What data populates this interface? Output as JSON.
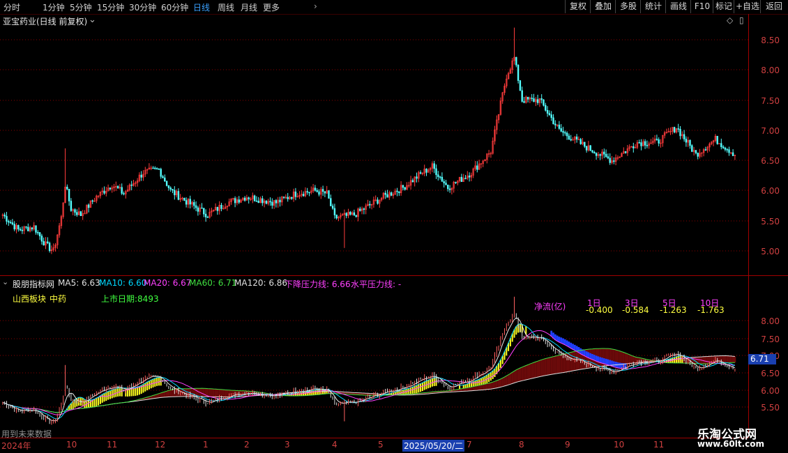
{
  "toolbar": {
    "timeframes": [
      "分时",
      "1分钟",
      "5分钟",
      "15分钟",
      "30分钟",
      "60分钟",
      "日线",
      "周线",
      "月线",
      "更多"
    ],
    "active_timeframe": "日线",
    "buttons": [
      "复权",
      "叠加",
      "多股",
      "统计",
      "画线",
      "F10",
      "标记",
      "+自选",
      "返回"
    ]
  },
  "main_panel": {
    "title": "亚宝药业(日线 前复权)",
    "y_ticks": [
      "8.50",
      "8.00",
      "7.50",
      "7.00",
      "6.50",
      "6.00",
      "5.50",
      "5.00"
    ]
  },
  "indicator_panel": {
    "name": "股朋指标网",
    "ma_items": [
      {
        "label": "MA5: 6.63",
        "color": "#e0e0e0"
      },
      {
        "label": "MA10: 6.60",
        "color": "#00d8ff"
      },
      {
        "label": "MA20: 6.67",
        "color": "#ff40ff"
      },
      {
        "label": "MA60: 6.71",
        "color": "#40e040"
      },
      {
        "label": "MA120: 6.86",
        "color": "#e0e0e0"
      },
      {
        "label": "下降压力线: 6.66",
        "color": "#ff40ff"
      },
      {
        "label": "水平压力线: -",
        "color": "#ff40ff"
      }
    ],
    "sector": "山西板块",
    "industry": "中药",
    "listing": "上市日期:8493",
    "netflow": {
      "label": "净流(亿)",
      "periods": [
        "1日",
        "3日",
        "5日",
        "10日"
      ],
      "values": [
        "-0.400",
        "-0.584",
        "-1.263",
        "-1.763"
      ]
    },
    "y_ticks": [
      "8.00",
      "7.50",
      "7.00",
      "6.50",
      "6.00",
      "5.50"
    ],
    "current_value": "6.71",
    "future_data_note": "用到未来数据"
  },
  "x_axis": {
    "labels": [
      "2024年",
      "10",
      "11",
      "12",
      "1",
      "2",
      "3",
      "4",
      "5",
      "2025/05/20/二",
      "7",
      "8",
      "9",
      "10",
      "11"
    ]
  },
  "watermark": {
    "title": "乐淘公式网",
    "url": "www.60lt.com"
  },
  "colors": {
    "up": "#ff3c3c",
    "down": "#54ffff",
    "grid": "#8b0000",
    "active": "#3aa0ff"
  }
}
